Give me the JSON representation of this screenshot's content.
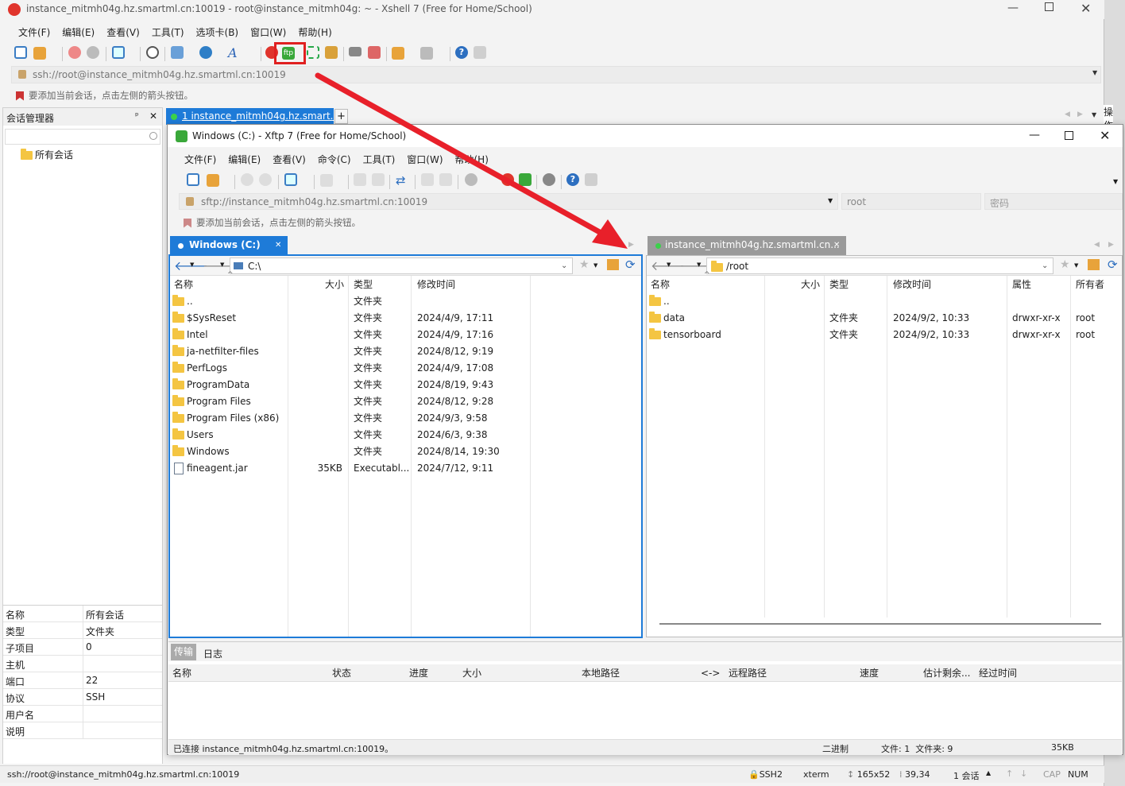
{
  "xshell": {
    "title": "instance_mitmh04g.hz.smartml.cn:10019 - root@instance_mitmh04g: ~ - Xshell 7 (Free for Home/School)",
    "menu": [
      "文件(F)",
      "编辑(E)",
      "查看(V)",
      "工具(T)",
      "选项卡(B)",
      "窗口(W)",
      "帮助(H)"
    ],
    "address": "ssh://root@instance_mitmh04g.hz.smartml.cn:10019",
    "hint": "要添加当前会话，点击左侧的箭头按钮。",
    "tab_label": "1 instance_mitmh04g.hz.smart...",
    "side_label": "操作",
    "session_manager": {
      "title": "会话管理器",
      "tree_root": "所有会话",
      "props": [
        {
          "k": "名称",
          "v": "所有会话"
        },
        {
          "k": "类型",
          "v": "文件夹"
        },
        {
          "k": "子项目",
          "v": "0"
        },
        {
          "k": "主机",
          "v": ""
        },
        {
          "k": "端口",
          "v": "22"
        },
        {
          "k": "协议",
          "v": "SSH"
        },
        {
          "k": "用户名",
          "v": ""
        },
        {
          "k": "说明",
          "v": ""
        }
      ]
    },
    "status": {
      "address": "ssh://root@instance_mitmh04g.hz.smartml.cn:10019",
      "proto": "SSH2",
      "term": "xterm",
      "size": "165x52",
      "pos": "39,34",
      "sessions": "1 会话",
      "cap": "CAP",
      "num": "NUM"
    }
  },
  "xftp": {
    "title": "Windows (C:)  - Xftp 7 (Free for Home/School)",
    "menu": [
      "文件(F)",
      "编辑(E)",
      "查看(V)",
      "命令(C)",
      "工具(T)",
      "窗口(W)",
      "帮助(H)"
    ],
    "address": "sftp://instance_mitmh04g.hz.smartml.cn:10019",
    "user": "root",
    "password_placeholder": "密码",
    "hint": "要添加当前会话，点击左侧的箭头按钮。",
    "local": {
      "tab": "Windows (C:)",
      "path": "C:\\",
      "headers": [
        "名称",
        "大小",
        "类型",
        "修改时间"
      ],
      "rows": [
        {
          "name": "..",
          "size": "",
          "type": "文件夹",
          "date": "",
          "kind": "folder"
        },
        {
          "name": "$SysReset",
          "size": "",
          "type": "文件夹",
          "date": "2024/4/9, 17:11",
          "kind": "folder"
        },
        {
          "name": "Intel",
          "size": "",
          "type": "文件夹",
          "date": "2024/4/9, 17:16",
          "kind": "folder"
        },
        {
          "name": "ja-netfilter-files",
          "size": "",
          "type": "文件夹",
          "date": "2024/8/12, 9:19",
          "kind": "folder"
        },
        {
          "name": "PerfLogs",
          "size": "",
          "type": "文件夹",
          "date": "2024/4/9, 17:08",
          "kind": "folder"
        },
        {
          "name": "ProgramData",
          "size": "",
          "type": "文件夹",
          "date": "2024/8/19, 9:43",
          "kind": "folder"
        },
        {
          "name": "Program Files",
          "size": "",
          "type": "文件夹",
          "date": "2024/8/12, 9:28",
          "kind": "folder"
        },
        {
          "name": "Program Files (x86)",
          "size": "",
          "type": "文件夹",
          "date": "2024/9/3, 9:58",
          "kind": "folder"
        },
        {
          "name": "Users",
          "size": "",
          "type": "文件夹",
          "date": "2024/6/3, 9:38",
          "kind": "folder"
        },
        {
          "name": "Windows",
          "size": "",
          "type": "文件夹",
          "date": "2024/8/14, 19:30",
          "kind": "folder"
        },
        {
          "name": "fineagent.jar",
          "size": "35KB",
          "type": "Executabl...",
          "date": "2024/7/12, 9:11",
          "kind": "file"
        }
      ]
    },
    "remote": {
      "tab": "instance_mitmh04g.hz.smartml.cn...",
      "path": "/root",
      "headers": [
        "名称",
        "大小",
        "类型",
        "修改时间",
        "属性",
        "所有者"
      ],
      "rows": [
        {
          "name": "..",
          "size": "",
          "type": "",
          "date": "",
          "attr": "",
          "owner": ""
        },
        {
          "name": "data",
          "size": "",
          "type": "文件夹",
          "date": "2024/9/2, 10:33",
          "attr": "drwxr-xr-x",
          "owner": "root"
        },
        {
          "name": "tensorboard",
          "size": "",
          "type": "文件夹",
          "date": "2024/9/2, 10:33",
          "attr": "drwxr-xr-x",
          "owner": "root"
        }
      ]
    },
    "transfer": {
      "tabs": [
        "传输",
        "日志"
      ],
      "headers": [
        "名称",
        "状态",
        "进度",
        "大小",
        "本地路径",
        "<->",
        "远程路径",
        "速度",
        "估计剩余...",
        "经过时间"
      ]
    },
    "status": {
      "connected": "已连接 instance_mitmh04g.hz.smartml.cn:10019。",
      "mode": "二进制",
      "counts": "文件: 1  文件夹: 9",
      "size": "35KB"
    }
  },
  "colors": {
    "accent": "#1e7bd8",
    "highlight_box": "#e02020",
    "arrow": "#e8202a",
    "xftp_green": "#3aa83a"
  }
}
